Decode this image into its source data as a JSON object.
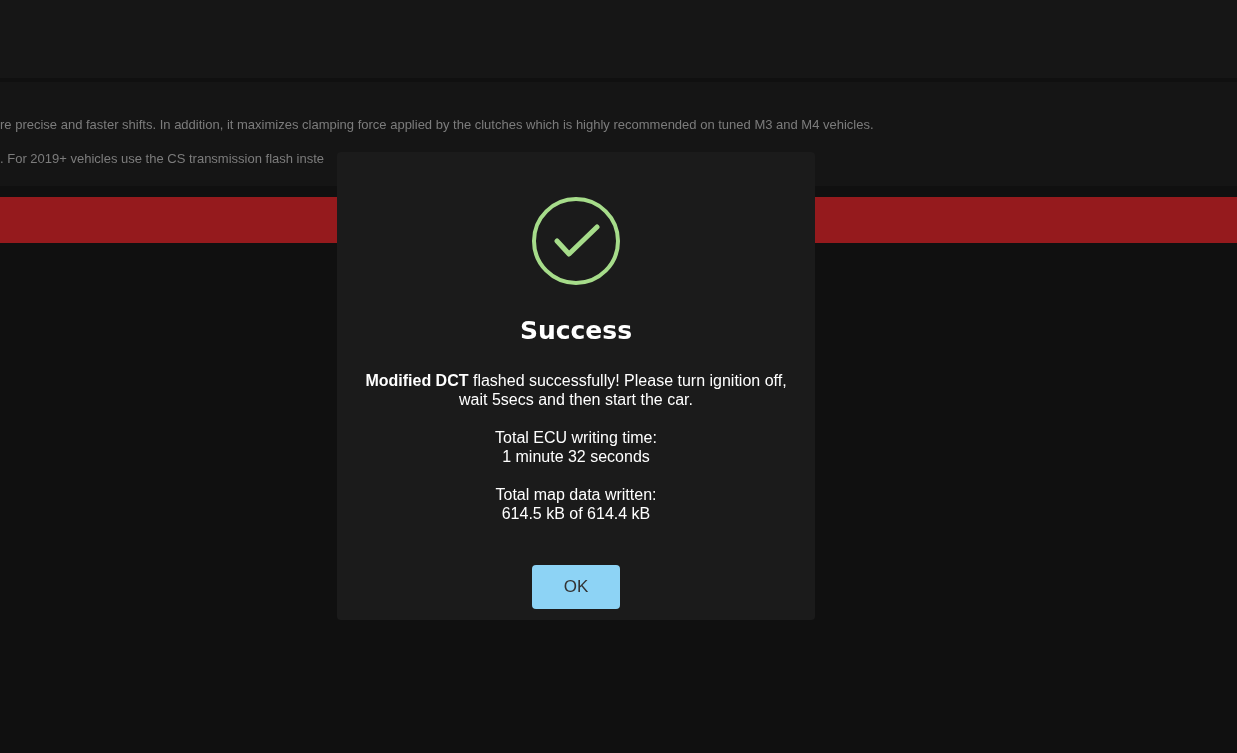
{
  "info_panel": {
    "lines": [
      "re precise and faster shifts. In addition, it maximizes clamping force applied by the clutches which is highly recommended on tuned M3 and M4 vehicles.",
      ". For 2019+ vehicles use the CS transmission flash inste"
    ]
  },
  "dialog": {
    "title": "Success",
    "message": "**Modified DCT** flashed successfully! Please turn ignition off, wait 5secs and then start the car.",
    "details": [
      {
        "label": "Total ECU writing time:",
        "value": "1 minute 32 seconds"
      },
      {
        "label": "Total map data written:",
        "value": "614.5 kB of 614.4 kB"
      }
    ],
    "button": "OK"
  }
}
